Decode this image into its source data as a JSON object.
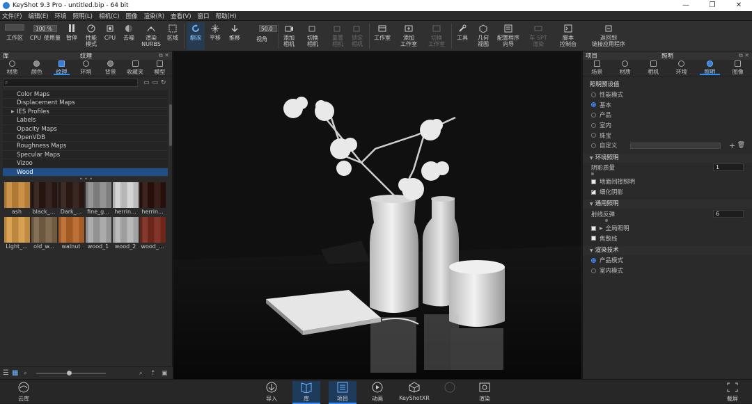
{
  "window": {
    "title": "KeyShot 9.3 Pro  - untitled.bip  - 64 bit",
    "controls": [
      "—",
      "❐",
      "✕"
    ]
  },
  "menu": [
    "文件(F)",
    "编辑(E)",
    "环境",
    "照明(L)",
    "相机(C)",
    "图像",
    "渲染(R)",
    "查看(V)",
    "窗口",
    "帮助(H)"
  ],
  "toolbar": {
    "zoom_value": "100 %",
    "fov_value": "50.0",
    "items": {
      "workspace": "工作区",
      "cpu": "CPU",
      "cpu_usage": "使用量",
      "pause": "暂停",
      "perf_mode_1": "性能",
      "perf_mode_2": "模式",
      "cpu2": "CPU",
      "denoise": "去噪",
      "render_nurbs_1": "渲染",
      "render_nurbs_2": "NURBS",
      "region": "区域",
      "tumble": "翻滚",
      "pan": "平移",
      "dolly": "推移",
      "view": "视角",
      "add_camera_1": "添加",
      "add_camera_2": "相机",
      "switch_camera_1": "切换",
      "switch_camera_2": "相机",
      "reset_camera_1": "重置",
      "reset_camera_2": "相机",
      "lock_camera_1": "锁定",
      "lock_camera_2": "相机",
      "studio": "工作室",
      "add_studio_1": "添加",
      "add_studio_2": "工作室",
      "switch_studio_1": "切换",
      "switch_studio_2": "工作室",
      "tools": "工具",
      "geometry_view_1": "几何",
      "geometry_view_2": "视图",
      "config_wizard_1": "配置程序",
      "config_wizard_2": "向导",
      "spt_1": "车 SPT",
      "spt_2": "渲染",
      "script_console_1": "脚本",
      "script_console_2": "控制台",
      "return_linked_1": "返回到",
      "return_linked_2": "链接应用程序"
    }
  },
  "library_panel": {
    "label": "库",
    "title": "纹理",
    "tabs": [
      "材质",
      "颜色",
      "纹理",
      "环境",
      "背景",
      "收藏夹",
      "模型"
    ],
    "active_tab": "纹理",
    "folders": [
      "Color Maps",
      "Displacement Maps",
      "IES Profiles",
      "Labels",
      "Opacity Maps",
      "OpenVDB",
      "Roughness Maps",
      "Specular Maps",
      "Vizoo",
      "Wood"
    ],
    "selected_folder": "Wood",
    "thumbnails": [
      {
        "name": "ash",
        "color": "#c88a3c"
      },
      {
        "name": "black_...",
        "color": "#2a1712"
      },
      {
        "name": "Dark_...",
        "color": "#2e1a14"
      },
      {
        "name": "fine_g...",
        "color": "#8d8d8d"
      },
      {
        "name": "herrin...",
        "color": "#d0d0d0"
      },
      {
        "name": "herrin...",
        "color": "#2c110c"
      },
      {
        "name": "Light_...",
        "color": "#d69a47"
      },
      {
        "name": "old_w...",
        "color": "#7a6448"
      },
      {
        "name": "walnut",
        "color": "#b8672a"
      },
      {
        "name": "wood_1",
        "color": "#a6a6a6"
      },
      {
        "name": "wood_2",
        "color": "#b4b4b4"
      },
      {
        "name": "wood_...",
        "color": "#7a2a1c"
      }
    ]
  },
  "properties_panel": {
    "label": "项目",
    "title": "照明",
    "tabs": [
      "场景",
      "材质",
      "相机",
      "环境",
      "照明",
      "图像"
    ],
    "active_tab": "照明",
    "presets_title": "照明预设值",
    "presets": [
      "性能模式",
      "基本",
      "产品",
      "室内",
      "珠宝",
      "自定义"
    ],
    "selected_preset": "基本",
    "env_lighting_title": "环境照明",
    "shadow_quality_label": "阴影质量",
    "shadow_quality_value": "1",
    "ground_indirect": "地面间接照明",
    "fine_shadows": "细化阴影",
    "general_lighting_title": "通用照明",
    "ray_bounces_label": "射线反弹",
    "ray_bounces_value": "6",
    "global_illumination": "全局照明",
    "caustics": "焦散线",
    "render_tech_title": "渲染技术",
    "render_techs": [
      "产品模式",
      "室内模式"
    ],
    "selected_render_tech": "产品模式"
  },
  "bottombar": {
    "cloud_library": "云库",
    "import": "导入",
    "library": "库",
    "project": "项目",
    "animation": "动画",
    "keyshotxr": "KeyShotXR",
    "render": "渲染",
    "screenshot": "截屏"
  }
}
